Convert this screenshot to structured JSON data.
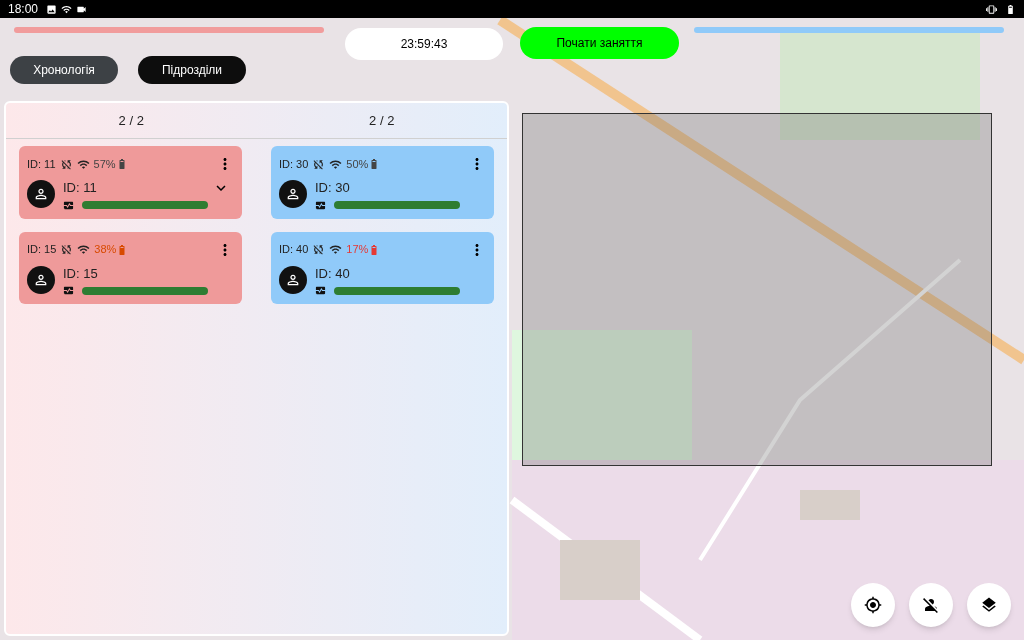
{
  "status_bar": {
    "time": "18:00"
  },
  "team_bars": [
    {
      "color": "#f19c9c"
    },
    {
      "color": "#90caf9"
    }
  ],
  "timer": "23:59:43",
  "start_button": "Почати заняття",
  "tabs": [
    {
      "label": "Хронологія",
      "selected": false
    },
    {
      "label": "Підрозділи",
      "selected": true
    }
  ],
  "columns": [
    {
      "count": "2 / 2",
      "color": "#ef9a9a",
      "units": [
        {
          "header_id": "ID: 11",
          "battery": "57%",
          "color": "#444444",
          "name": "ID: 11",
          "expandable": true
        },
        {
          "header_id": "ID: 15",
          "battery": "38%",
          "color": "#d84a00",
          "name": "ID: 15",
          "expandable": false
        }
      ]
    },
    {
      "count": "2 / 2",
      "color": "#90caf9",
      "units": [
        {
          "header_id": "ID: 30",
          "battery": "50%",
          "color": "#444444",
          "name": "ID: 30",
          "expandable": false
        },
        {
          "header_id": "ID: 40",
          "battery": "17%",
          "color": "#e53935",
          "name": "ID: 40",
          "expandable": false
        }
      ]
    }
  ]
}
